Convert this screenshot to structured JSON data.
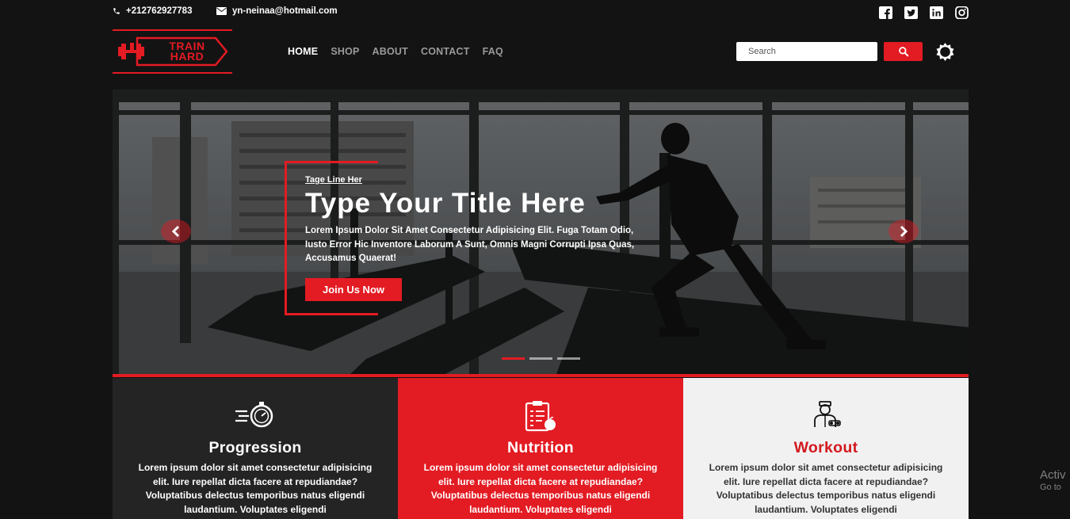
{
  "topbar": {
    "phone": "+212762927783",
    "email": "yn-neinaa@hotmail.com",
    "socials": [
      "facebook-icon",
      "twitter-icon",
      "linkedin-icon",
      "instagram-icon"
    ]
  },
  "logo": {
    "line1": "TRAIN",
    "line2": "HARD"
  },
  "nav": {
    "items": [
      {
        "label": "HOME",
        "active": true
      },
      {
        "label": "SHOP"
      },
      {
        "label": "ABOUT"
      },
      {
        "label": "CONTACT"
      },
      {
        "label": "FAQ"
      }
    ]
  },
  "search": {
    "placeholder": "Search"
  },
  "hero": {
    "tagline": "Tage Line Her",
    "title": "Type Your Title Here",
    "description": "Lorem Ipsum Dolor Sit Amet Consectetur Adipisicing Elit. Fuga Totam Odio, Iusto Error Hic Inventore Laborum A Sunt, Omnis Magni Corrupti Ipsa Quas, Accusamus Quaerat!",
    "button": "Join Us Now",
    "slides": 3,
    "active_slide": 1
  },
  "features": [
    {
      "title": "Progression",
      "icon": "stopwatch-icon",
      "text": "Lorem ipsum dolor sit amet consectetur adipisicing elit. Iure repellat dicta facere at repudiandae? Voluptatibus delectus temporibus natus eligendi laudantium. Voluptates eligendi"
    },
    {
      "title": "Nutrition",
      "icon": "nutrition-plan-icon",
      "text": "Lorem ipsum dolor sit amet consectetur adipisicing elit. Iure repellat dicta facere at repudiandae? Voluptatibus delectus temporibus natus eligendi laudantium. Voluptates eligendi"
    },
    {
      "title": "Workout",
      "icon": "trainer-icon",
      "text": "Lorem ipsum dolor sit amet consectetur adipisicing elit. Iure repellat dicta facere at repudiandae? Voluptatibus delectus temporibus natus eligendi laudantium. Voluptates eligendi"
    }
  ],
  "watermark": {
    "title": "Activ",
    "subtitle": "Go to"
  },
  "colors": {
    "accent": "#e31b23",
    "background": "#131313",
    "panel_dark": "#242424",
    "panel_light": "#f1f1f1"
  }
}
